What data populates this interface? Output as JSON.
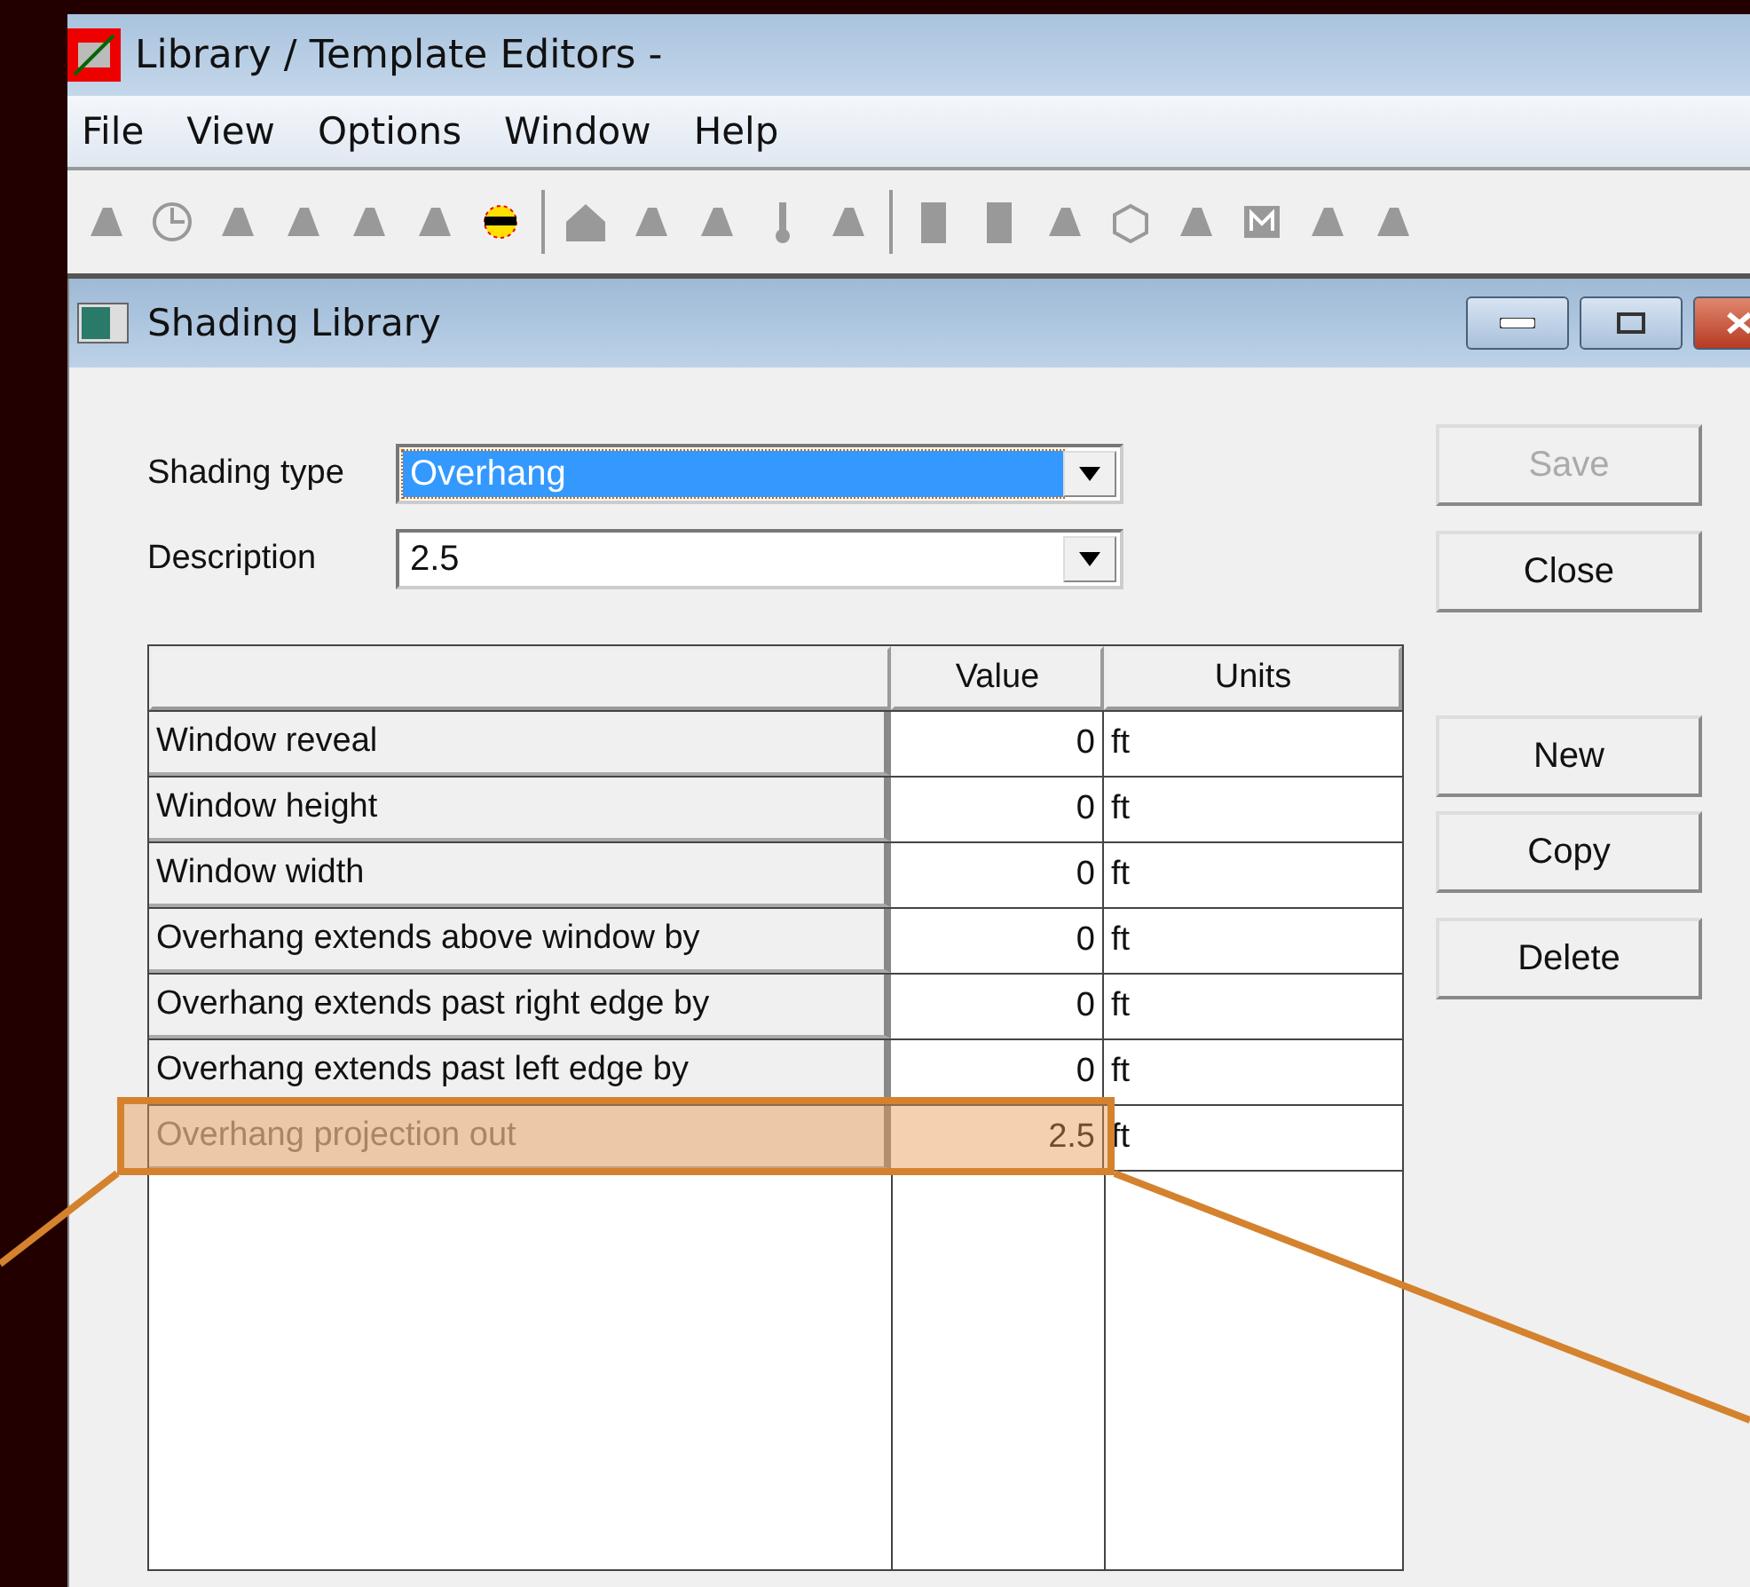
{
  "window": {
    "title": "Library / Template Editors -"
  },
  "menu": [
    "File",
    "View",
    "Options",
    "Window",
    "Help"
  ],
  "child_window": {
    "title": "Shading Library"
  },
  "fields": [
    {
      "label": "Shading type",
      "value": "Overhang",
      "focused": true
    },
    {
      "label": "Description",
      "value": "2.5",
      "focused": false
    }
  ],
  "table": {
    "columns": [
      "",
      "Value",
      "Units"
    ],
    "rows": [
      {
        "label": "Window reveal",
        "value": "0",
        "units": "ft",
        "highlighted": false,
        "disabled": false
      },
      {
        "label": "Window height",
        "value": "0",
        "units": "ft",
        "highlighted": false,
        "disabled": false
      },
      {
        "label": "Window width",
        "value": "0",
        "units": "ft",
        "highlighted": false,
        "disabled": false
      },
      {
        "label": "Overhang extends above window by",
        "value": "0",
        "units": "ft",
        "highlighted": false,
        "disabled": false
      },
      {
        "label": "Overhang extends past right edge by",
        "value": "0",
        "units": "ft",
        "highlighted": false,
        "disabled": false
      },
      {
        "label": "Overhang extends past left edge by",
        "value": "0",
        "units": "ft",
        "highlighted": false,
        "disabled": false
      },
      {
        "label": "Overhang projection out",
        "value": "2.5",
        "units": "ft",
        "highlighted": true,
        "disabled": true
      }
    ]
  },
  "buttons": [
    {
      "label": "Save",
      "disabled": true
    },
    {
      "label": "Close",
      "disabled": false
    },
    {
      "label": "New",
      "disabled": false
    },
    {
      "label": "Copy",
      "disabled": false
    },
    {
      "label": "Delete",
      "disabled": false
    }
  ]
}
